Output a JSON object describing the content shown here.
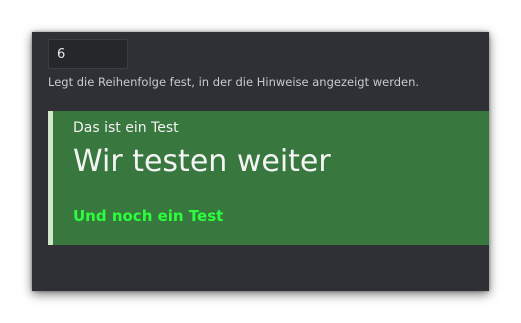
{
  "order_field": {
    "value": "6",
    "help_text": "Legt die Reihenfolge fest, in der die Hinweise angezeigt werden."
  },
  "notice_preview": {
    "line_small": "Das ist ein Test",
    "line_large": "Wir testen weiter",
    "line_green": "Und noch ein Test"
  },
  "colors": {
    "panel_background": "#2e3035",
    "notice_background": "#38783f",
    "notice_border": "#cfe8c9",
    "highlight_text": "#2bff3c"
  }
}
